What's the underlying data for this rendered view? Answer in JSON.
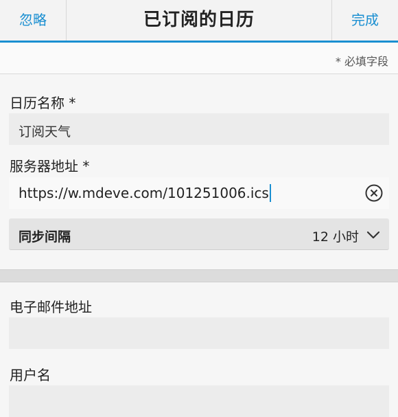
{
  "header": {
    "left_label": "忽略",
    "title": "已订阅的日历",
    "right_label": "完成"
  },
  "required_note": "* 必填字段",
  "form": {
    "calendar_name": {
      "label": "日历名称 *",
      "value": "订阅天气"
    },
    "server_address": {
      "label": "服务器地址 *",
      "value": "https://w.mdeve.com/101251006.ics"
    },
    "sync_interval": {
      "label": "同步间隔",
      "value": "12 小时"
    },
    "email": {
      "label": "电子邮件地址",
      "value": ""
    },
    "username": {
      "label": "用户名",
      "value": ""
    }
  },
  "icons": {
    "clear": "clear-circle-x-icon",
    "dropdown": "chevron-down-icon"
  },
  "colors": {
    "accent": "#1a8fd1",
    "background": "#f6f6f6",
    "field": "#ececec"
  }
}
